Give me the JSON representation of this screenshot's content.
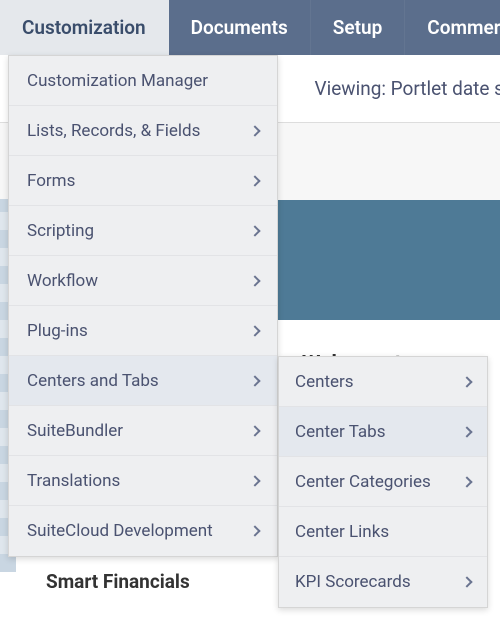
{
  "topnav": {
    "items": [
      {
        "label": "Customization",
        "active": true
      },
      {
        "label": "Documents"
      },
      {
        "label": "Setup"
      },
      {
        "label": "Commerce"
      }
    ]
  },
  "viewing_text": "Viewing: Portlet date s",
  "welcome_text": "Welcome to",
  "smart_text": "Smart Financials",
  "menu1": {
    "items": [
      {
        "label": "Customization Manager",
        "has_children": false
      },
      {
        "label": "Lists, Records, & Fields",
        "has_children": true
      },
      {
        "label": "Forms",
        "has_children": true
      },
      {
        "label": "Scripting",
        "has_children": true
      },
      {
        "label": "Workflow",
        "has_children": true
      },
      {
        "label": "Plug-ins",
        "has_children": true
      },
      {
        "label": "Centers and Tabs",
        "has_children": true,
        "hover": true
      },
      {
        "label": "SuiteBundler",
        "has_children": true
      },
      {
        "label": "Translations",
        "has_children": true
      },
      {
        "label": "SuiteCloud Development",
        "has_children": true
      }
    ]
  },
  "menu2": {
    "items": [
      {
        "label": "Centers",
        "has_children": true
      },
      {
        "label": "Center Tabs",
        "has_children": true,
        "hover": true
      },
      {
        "label": "Center Categories",
        "has_children": true
      },
      {
        "label": "Center Links",
        "has_children": false
      },
      {
        "label": "KPI Scorecards",
        "has_children": true
      }
    ]
  }
}
